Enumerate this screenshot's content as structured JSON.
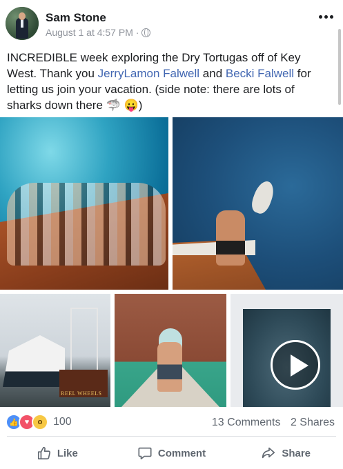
{
  "post": {
    "author": "Sam Stone",
    "timestamp": "August 1 at 4:57 PM ·",
    "privacy_icon": "globe-icon",
    "text_part1": "INCREDIBLE week exploring the Dry Tortugas off of Key West. Thank you ",
    "mention1": "JerryLamon Falwell",
    "text_part2": " and ",
    "mention2": "Becki Falwell",
    "text_part3": " for letting us join your vacation. (side note: there are lots of sharks down there ",
    "emoji": "🦈 😛",
    "text_part4": ")"
  },
  "photos": {
    "boat_sign": "REEL WHEELS"
  },
  "stats": {
    "reaction_count": "100",
    "comments": "13 Comments",
    "shares": "2 Shares"
  },
  "actions": {
    "like": "Like",
    "comment": "Comment",
    "share": "Share"
  },
  "colors": {
    "link": "#4267b2",
    "muted": "#606770"
  }
}
